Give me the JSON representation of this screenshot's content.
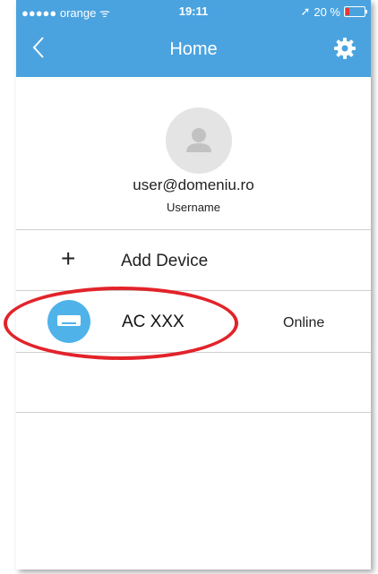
{
  "status_bar": {
    "carrier": "●●●●● orange ᯤ",
    "time": "19:11",
    "battery": "20 %",
    "battery_level": 0.2
  },
  "nav": {
    "back_icon": "chevron-left-icon",
    "title": "Home",
    "settings_icon": "gear-icon",
    "color": "#4aa3df"
  },
  "profile": {
    "avatar_icon": "user-silhouette-icon",
    "email": "user@domeniu.ro",
    "username": "Username"
  },
  "add_device": {
    "icon": "plus-icon",
    "label": "Add Device"
  },
  "devices": [
    {
      "icon": "air-conditioner-icon",
      "name": "AC XXX",
      "status": "Online"
    }
  ],
  "annotation": {
    "color": "#e2232a"
  }
}
